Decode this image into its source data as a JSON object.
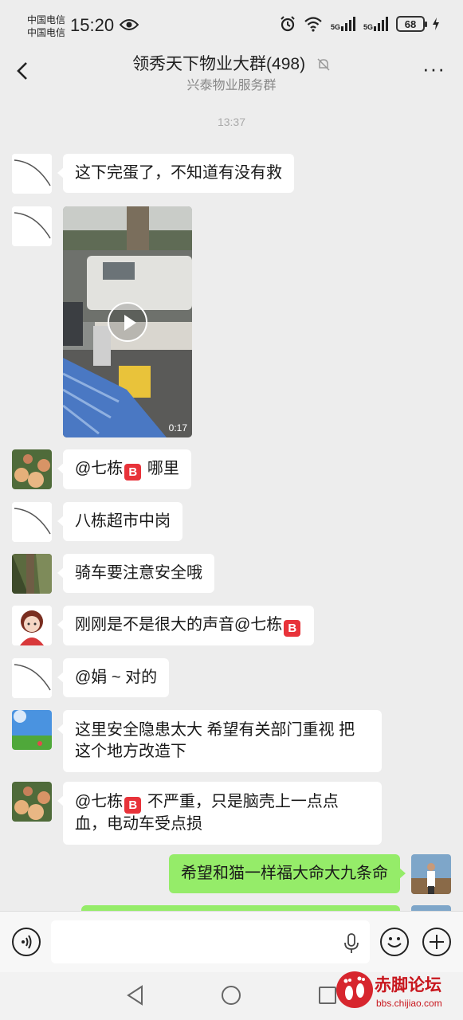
{
  "status_bar": {
    "carrier1": "中国电信",
    "carrier2": "中国电信",
    "time": "15:20",
    "net1": "5G",
    "net2": "5G",
    "battery": "68"
  },
  "header": {
    "title": "领秀天下物业大群(498)",
    "subtitle": "兴泰物业服务群",
    "more": "···"
  },
  "chat": {
    "time_label": "13:37",
    "messages": [
      {
        "text": "这下完蛋了，不知道有没有救"
      },
      {
        "video_duration": "0:17"
      },
      {
        "text_a": "@七栋",
        "text_b": " 哪里"
      },
      {
        "text": "八栋超市中岗"
      },
      {
        "text": "骑车要注意安全哦"
      },
      {
        "text_a": "刚刚是不是很大的声音@七栋"
      },
      {
        "text": "@娟 ~  对的"
      },
      {
        "text": "这里安全隐患太大 希望有关部门重视 把这个地方改造下"
      },
      {
        "text_a": "@七栋",
        "text_b": " 不严重，只是脑壳上一点点血，电动车受点损"
      },
      {
        "text": "希望和猫一样福大命大九条命"
      }
    ],
    "badge": "B"
  },
  "watermark": {
    "title": "赤脚论坛",
    "url": "bbs.chijiao.com"
  }
}
